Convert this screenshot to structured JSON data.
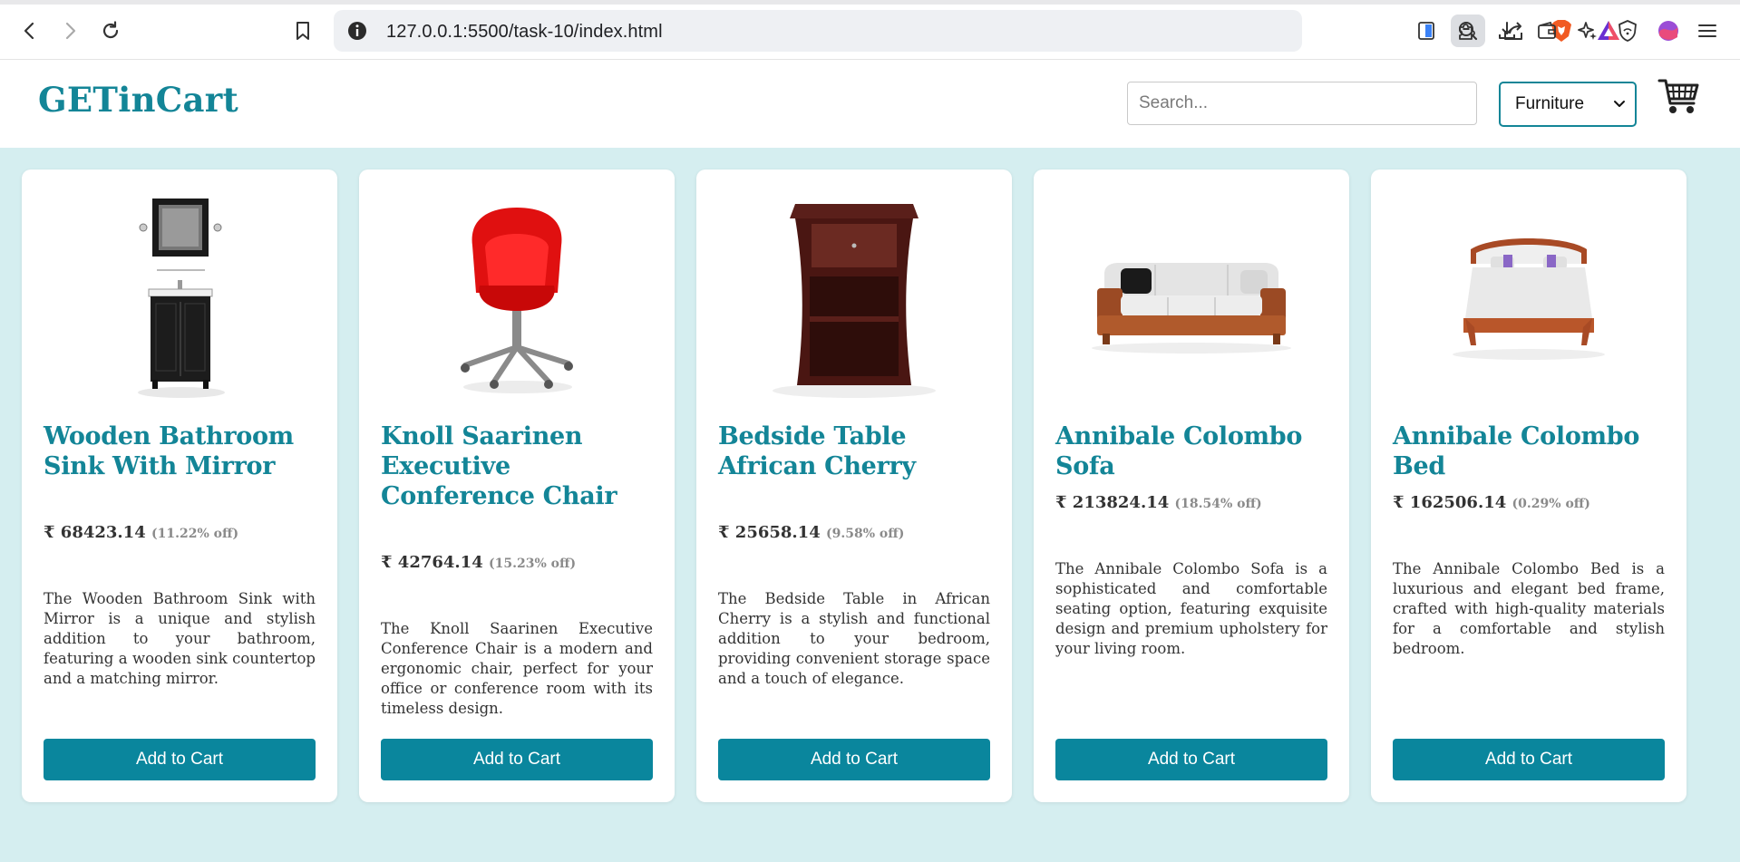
{
  "browser": {
    "url": "127.0.0.1:5500/task-10/index.html"
  },
  "site": {
    "brand": "GETinCart",
    "search_placeholder": "Search...",
    "category_selected": "Furniture"
  },
  "products": [
    {
      "title": "Wooden Bathroom Sink With Mirror",
      "price": "₹ 68423.14",
      "discount": "(11.22% off)",
      "description": "The Wooden Bathroom Sink with Mirror is a unique and stylish addition to your bathroom, featuring a wooden sink countertop and a matching mirror.",
      "button": "Add to Cart"
    },
    {
      "title": "Knoll Saarinen Executive Conference Chair",
      "price": "₹ 42764.14",
      "discount": "(15.23% off)",
      "description": "The Knoll Saarinen Executive Conference Chair is a modern and ergonomic chair, perfect for your office or conference room with its timeless design.",
      "button": "Add to Cart"
    },
    {
      "title": "Bedside Table African Cherry",
      "price": "₹ 25658.14",
      "discount": "(9.58% off)",
      "description": "The Bedside Table in African Cherry is a stylish and functional addition to your bedroom, providing convenient storage space and a touch of elegance.",
      "button": "Add to Cart"
    },
    {
      "title": "Annibale Colombo Sofa",
      "price": "₹ 213824.14",
      "discount": "(18.54% off)",
      "description": "The Annibale Colombo Sofa is a sophisticated and comfortable seating option, featuring exquisite design and premium upholstery for your living room.",
      "button": "Add to Cart"
    },
    {
      "title": "Annibale Colombo Bed",
      "price": "₹ 162506.14",
      "discount": "(0.29% off)",
      "description": "The Annibale Colombo Bed is a luxurious and elegant bed frame, crafted with high-quality materials for a comfortable and stylish bedroom.",
      "button": "Add to Cart"
    }
  ],
  "colors": {
    "accent": "#138597",
    "button": "#0a869d",
    "page_background": "#d5eef0"
  },
  "icons": [
    "back-icon",
    "forward-icon",
    "reload-icon",
    "bookmark-icon",
    "info-icon",
    "zoom-out-icon",
    "share-icon",
    "brave-shield-icon",
    "brave-rewards-icon",
    "sidebar-icon",
    "extensions-icon",
    "download-icon",
    "wallet-icon",
    "leo-ai-icon",
    "vpn-icon",
    "profile-icon",
    "menu-icon",
    "cart-icon"
  ]
}
